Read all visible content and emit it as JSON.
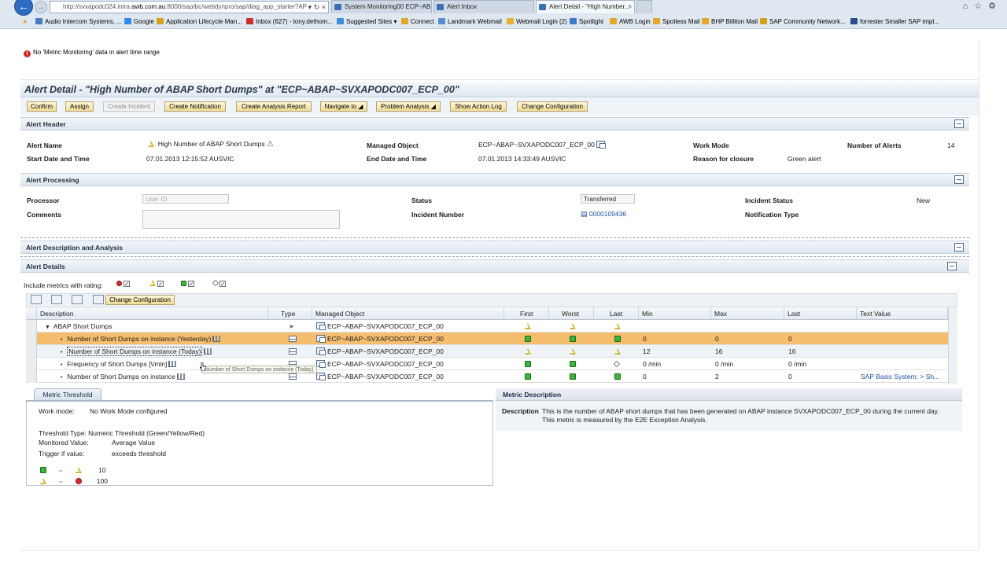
{
  "browser": {
    "url_prefix": "http://svxapodc024.intra.",
    "url_host": "awb.com.au",
    "url_suffix": ":8000/sap/bc/webdynpro/sap/diag_app_starter?AP",
    "tabs": [
      {
        "label": "System Monitoring00 ECP~AB...",
        "active": false
      },
      {
        "label": "Alert Inbox",
        "active": false
      },
      {
        "label": "Alert Detail - \"High Number...",
        "active": true
      }
    ],
    "favorites": [
      {
        "label": "Audio Intercom Systems, ...",
        "color": "#4b7bc2"
      },
      {
        "label": "Google",
        "color": "#2f8ce8"
      },
      {
        "label": "Application Lifecycle Man...",
        "color": "#d3a21b"
      },
      {
        "label": "Inbox (627) - tony.dethom...",
        "color": "#c9302c"
      },
      {
        "label": "Suggested Sites ▾",
        "color": "#3b8fd8"
      },
      {
        "label": "Connect",
        "color": "#e1a82c"
      },
      {
        "label": "Landmark Webmail",
        "color": "#5a8bd0"
      },
      {
        "label": "Webmail Login (2)",
        "color": "#e5b330"
      },
      {
        "label": "Spotlight",
        "color": "#3a7cc9"
      },
      {
        "label": "AWB Login",
        "color": "#e1a82c"
      },
      {
        "label": "Spotless Mail",
        "color": "#e1a82c"
      },
      {
        "label": "BHP Billiton Mail",
        "color": "#e1a82c"
      },
      {
        "label": "SAP Community Network...",
        "color": "#d3a21b"
      },
      {
        "label": "forrester Smaller SAP impl...",
        "color": "#2a4f8f"
      }
    ]
  },
  "message": {
    "icon": "error-icon",
    "text": "No 'Metric Monitoring' data in alert time range"
  },
  "title": "Alert Detail - \"High Number of ABAP Short Dumps\" at \"ECP~ABAP~SVXAPODC007_ECP_00\"",
  "toolbar": {
    "buttons": [
      {
        "label": "Confirm",
        "disabled": false
      },
      {
        "label": "Assign",
        "disabled": false
      },
      {
        "label": "Create Incident",
        "disabled": true
      },
      {
        "label": "Create Notification",
        "disabled": false
      },
      {
        "label": "Create Analysis Report",
        "disabled": false
      },
      {
        "label": "Navigate to ◢",
        "disabled": false
      },
      {
        "label": "Problem Analysis ◢",
        "disabled": false
      },
      {
        "label": "Show Action Log",
        "disabled": false
      },
      {
        "label": "Change Configuration",
        "disabled": false
      }
    ]
  },
  "alert_header": {
    "section_title": "Alert Header",
    "alert_name_label": "Alert Name",
    "alert_name": "High Number of ABAP Short Dumps",
    "start_label": "Start Date and Time",
    "start": "07.01.2013 12:15:52 AUSVIC",
    "managed_object_label": "Managed Object",
    "managed_object": "ECP~ABAP~SVXAPODC007_ECP_00",
    "end_label": "End Date and Time",
    "end": "07.01.2013 14:33:49 AUSVIC",
    "work_mode_label": "Work Mode",
    "reason_label": "Reason for closure",
    "reason": "Green alert",
    "num_alerts_label": "Number of Alerts",
    "num_alerts": "14"
  },
  "alert_processing": {
    "section_title": "Alert Processing",
    "processor_label": "Processor",
    "processor_placeholder": "User ID",
    "comments_label": "Comments",
    "status_label": "Status",
    "status": "Transferred",
    "incident_number_label": "Incident Number",
    "incident_number": "0000109436",
    "incident_status_label": "Incident Status",
    "incident_status": "New",
    "notification_type_label": "Notification Type"
  },
  "alert_description": {
    "section_title": "Alert Description and Analysis"
  },
  "alert_details": {
    "section_title": "Alert Details",
    "include_label": "Include metrics with rating:",
    "change_config_label": "Change Configuration",
    "columns": [
      "Description",
      "Type",
      "Managed Object",
      "First",
      "Worst",
      "Last",
      "Min",
      "Max",
      "Last",
      "Text Value"
    ],
    "rows": [
      {
        "desc": "ABAP Short Dumps",
        "type": "arrow",
        "mo": "ECP~ABAP~SVXAPODC007_ECP_00",
        "first": "yellow",
        "worst": "yellow",
        "last": "yellow",
        "min": "",
        "max": "",
        "lastv": "",
        "text": "",
        "level": 0
      },
      {
        "desc": "Number of Short Dumps on instance (Yesterday)",
        "type": "table",
        "mo": "ECP~ABAP~SVXAPODC007_ECP_00",
        "first": "green",
        "worst": "green",
        "last": "green",
        "min": "0",
        "max": "0",
        "lastv": "0",
        "text": "",
        "level": 1
      },
      {
        "desc": "Number of Short Dumps on instance (Today)",
        "type": "table",
        "mo": "ECP~ABAP~SVXAPODC007_ECP_00",
        "first": "yellow",
        "worst": "yellow",
        "last": "yellow",
        "min": "12",
        "max": "16",
        "lastv": "16",
        "text": "",
        "level": 1
      },
      {
        "desc": "Frequency of Short Dumps [\\/min]",
        "type": "table",
        "mo": "ECP~ABAP~SVXAPODC007_ECP_00",
        "first": "green",
        "worst": "green",
        "last": "grey",
        "min": "0 /min",
        "max": "0 /min",
        "lastv": "0 /min",
        "text": "",
        "level": 1
      },
      {
        "desc": "Number of Short Dumps on instance",
        "type": "table",
        "mo": "ECP~ABAP~SVXAPODC007_ECP_00",
        "first": "green",
        "worst": "green",
        "last": "green",
        "min": "0",
        "max": "2",
        "lastv": "0",
        "text": "SAP Basis System: > Sh...",
        "level": 1
      }
    ],
    "tooltip": "Number of Short Dumps on instance (Today)"
  },
  "metric_threshold": {
    "tab_label": "Metric Threshold",
    "work_mode_label": "Work mode:",
    "work_mode": "No Work Mode configured",
    "threshold_type": "Threshold Type: Numeric Threshold (Green/Yellow/Red)",
    "monitored_label": "Monitored Value:",
    "monitored": "Average Value",
    "trigger_label": "Trigger if value:",
    "trigger": "exceeds threshold",
    "t1": "10",
    "t2": "100"
  },
  "metric_description": {
    "header": "Metric Description",
    "label": "Description",
    "line1": "This is the number of ABAP short dumps that has been generated on ABAP instance SVXAPODC007_ECP_00 during the current day.",
    "line2": "This metric is measured by the E2E Exception Analysis."
  }
}
